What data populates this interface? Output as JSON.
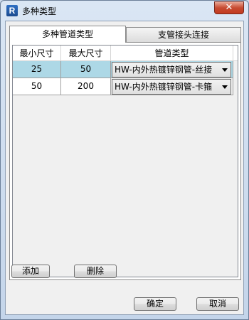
{
  "window": {
    "title": "多种类型",
    "app_icon": "R",
    "close_glyph": "✕"
  },
  "tabs": [
    {
      "label": "多种管道类型",
      "active": true
    },
    {
      "label": "支管接头连接",
      "active": false
    }
  ],
  "table": {
    "columns": [
      "最小尺寸",
      "最大尺寸",
      "管道类型"
    ],
    "rows": [
      {
        "min": "25",
        "max": "50",
        "type": "HW-内外热镀锌钢管-丝接",
        "selected": true
      },
      {
        "min": "50",
        "max": "200",
        "type": "HW-内外热镀锌钢管-卡箍",
        "selected": false
      }
    ]
  },
  "buttons": {
    "add": "添加",
    "delete": "删除",
    "ok": "确定",
    "cancel": "取消"
  },
  "colors": {
    "selection": "#add8e6",
    "close": "#c74b32"
  }
}
